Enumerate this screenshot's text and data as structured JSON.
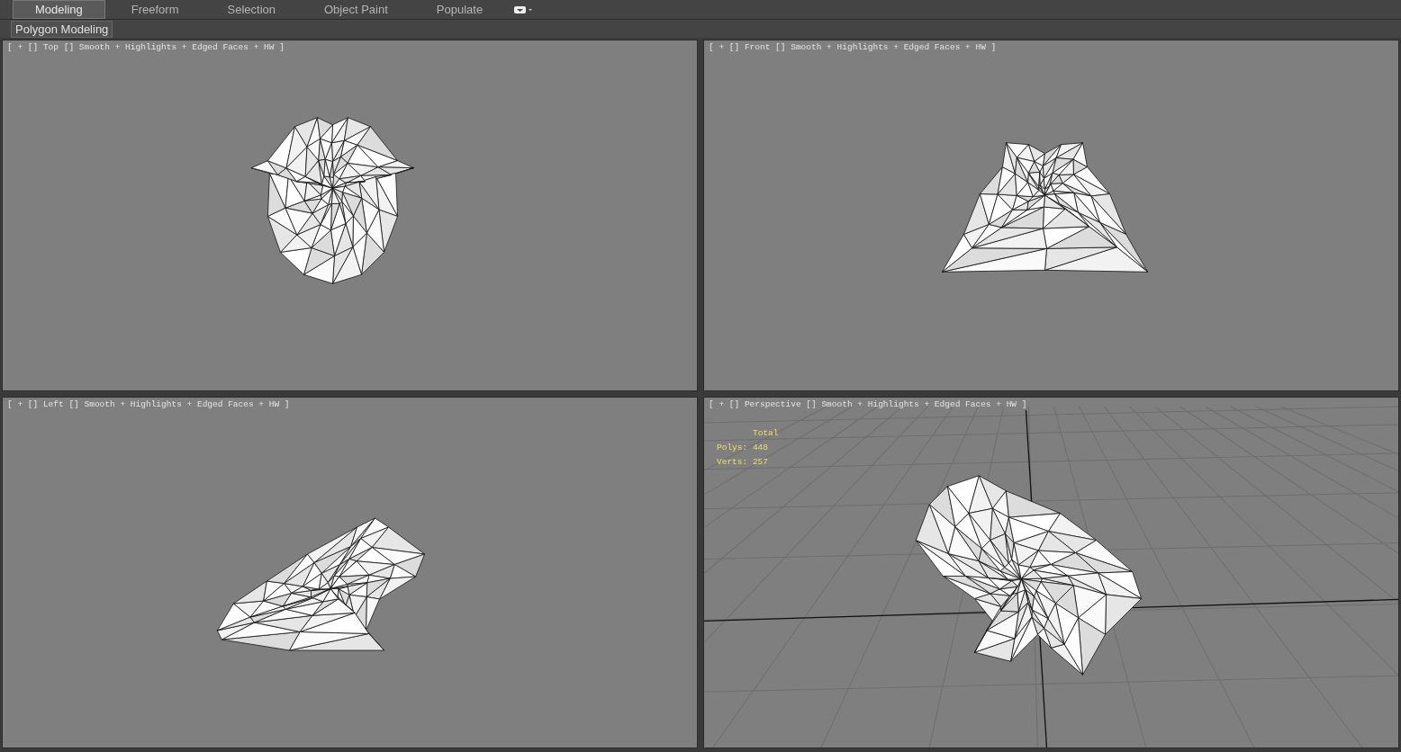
{
  "tabs": [
    {
      "label": "Modeling",
      "selected": true
    },
    {
      "label": "Freeform",
      "selected": false
    },
    {
      "label": "Selection",
      "selected": false
    },
    {
      "label": "Object Paint",
      "selected": false
    },
    {
      "label": "Populate",
      "selected": false
    }
  ],
  "ribbon_panel": {
    "label": "Polygon Modeling"
  },
  "viewports": [
    {
      "kind": "top",
      "label": "[ + [] Top [] Smooth + Highlights + Edged Faces + HW ]"
    },
    {
      "kind": "front",
      "label": "[ + [] Front [] Smooth + Highlights + Edged Faces + HW ]"
    },
    {
      "kind": "left",
      "label": "[ + [] Left [] Smooth + Highlights + Edged Faces + HW ]"
    },
    {
      "kind": "perspective",
      "label": "[ + [] Perspective [] Smooth + Highlights + Edged Faces + HW ]",
      "stats": {
        "title": "Total",
        "lines": [
          "Polys: 448",
          "Verts: 257"
        ]
      }
    }
  ]
}
